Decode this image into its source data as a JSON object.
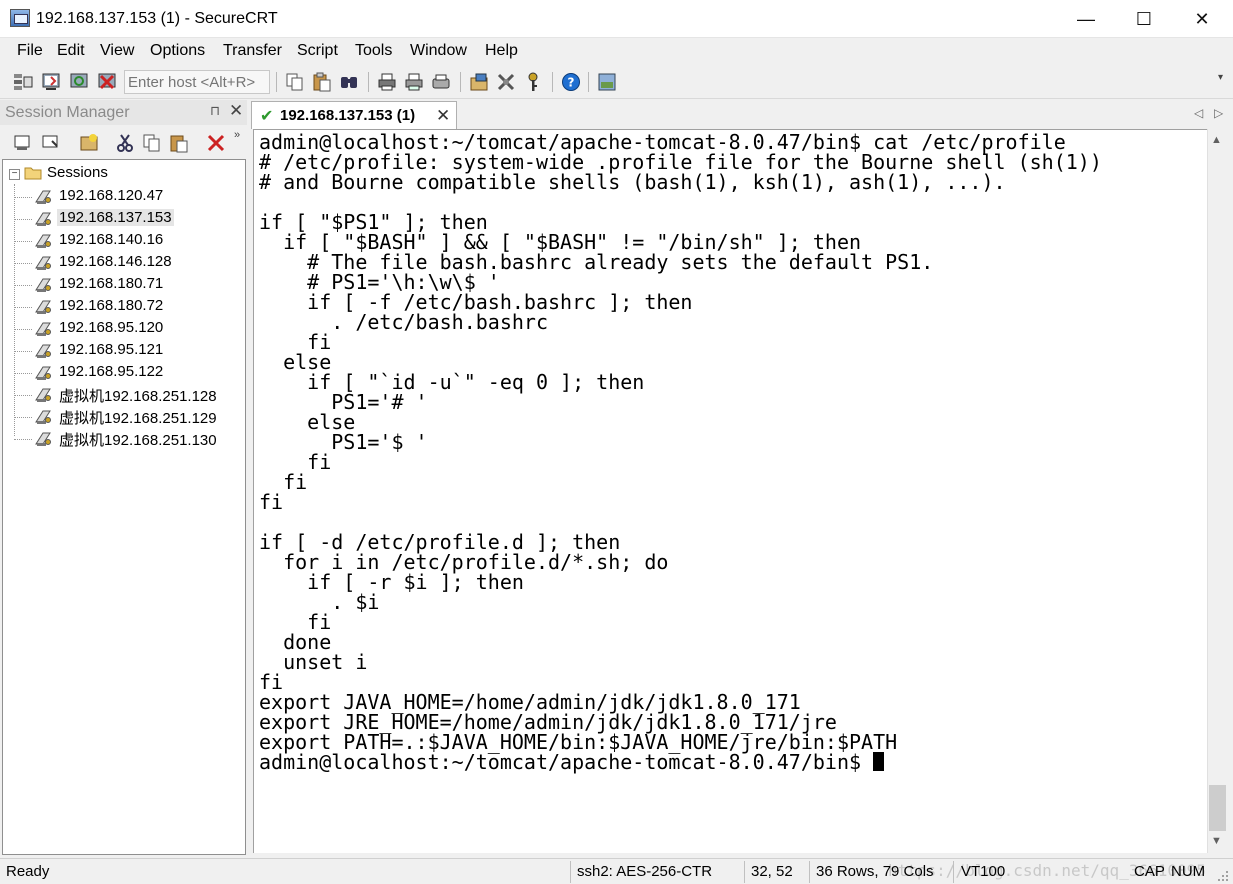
{
  "window": {
    "title": "192.168.137.153 (1) - SecureCRT",
    "minimize": "—",
    "maximize": "☐",
    "close": "✕"
  },
  "menu": [
    "File",
    "Edit",
    "View",
    "Options",
    "Transfer",
    "Script",
    "Tools",
    "Window",
    "Help"
  ],
  "toolbar": {
    "host_placeholder": "Enter host <Alt+R>",
    "icons": [
      "connect-icon",
      "quick-connect-icon",
      "reconnect-icon",
      "disconnect-icon",
      "copy-icon",
      "paste-icon",
      "find-icon",
      "print-icon",
      "print-selection-icon",
      "printer-setup-icon",
      "session-options-icon",
      "global-options-icon",
      "keymap-icon",
      "help-icon",
      "screenshot-icon"
    ],
    "overflow": "▾"
  },
  "session_manager": {
    "title": "Session Manager",
    "pin": "⊓",
    "close": "✕",
    "root_label": "Sessions",
    "sessions": [
      "192.168.120.47",
      "192.168.137.153",
      "192.168.140.16",
      "192.168.146.128",
      "192.168.180.71",
      "192.168.180.72",
      "192.168.95.120",
      "192.168.95.121",
      "192.168.95.122",
      "虚拟机192.168.251.128",
      "虚拟机192.168.251.129",
      "虚拟机192.168.251.130"
    ],
    "selected_index": 1
  },
  "tab": {
    "label": "192.168.137.153 (1)",
    "check": "✔",
    "close": "✕",
    "nav_left": "◁",
    "nav_right": "▷"
  },
  "terminal": {
    "lines": [
      "admin@localhost:~/tomcat/apache-tomcat-8.0.47/bin$ cat /etc/profile",
      "# /etc/profile: system-wide .profile file for the Bourne shell (sh(1))",
      "# and Bourne compatible shells (bash(1), ksh(1), ash(1), ...).",
      "",
      "if [ \"$PS1\" ]; then",
      "  if [ \"$BASH\" ] && [ \"$BASH\" != \"/bin/sh\" ]; then",
      "    # The file bash.bashrc already sets the default PS1.",
      "    # PS1='\\h:\\w\\$ '",
      "    if [ -f /etc/bash.bashrc ]; then",
      "      . /etc/bash.bashrc",
      "    fi",
      "  else",
      "    if [ \"`id -u`\" -eq 0 ]; then",
      "      PS1='# '",
      "    else",
      "      PS1='$ '",
      "    fi",
      "  fi",
      "fi",
      "",
      "if [ -d /etc/profile.d ]; then",
      "  for i in /etc/profile.d/*.sh; do",
      "    if [ -r $i ]; then",
      "      . $i",
      "    fi",
      "  done",
      "  unset i",
      "fi",
      "export JAVA_HOME=/home/admin/jdk/jdk1.8.0_171",
      "export JRE_HOME=/home/admin/jdk/jdk1.8.0_171/jre",
      "export PATH=.:$JAVA_HOME/bin:$JAVA_HOME/jre/bin:$PATH"
    ],
    "prompt": "admin@localhost:~/tomcat/apache-tomcat-8.0.47/bin$ "
  },
  "scrollbar": {
    "up": "▲",
    "down": "▼"
  },
  "status": {
    "ready": "Ready",
    "cipher": "ssh2: AES-256-CTR",
    "position": "32,  52",
    "size": "36 Rows, 79 Cols",
    "emulation": "VT100",
    "caps": "CAP",
    "num": "NUM",
    "watermark": "https://blog.csdn.net/qq_36610095"
  },
  "colors": {
    "check_green": "#2e9a2e",
    "delete_red": "#cc2222",
    "help_blue": "#1f6fd1"
  }
}
